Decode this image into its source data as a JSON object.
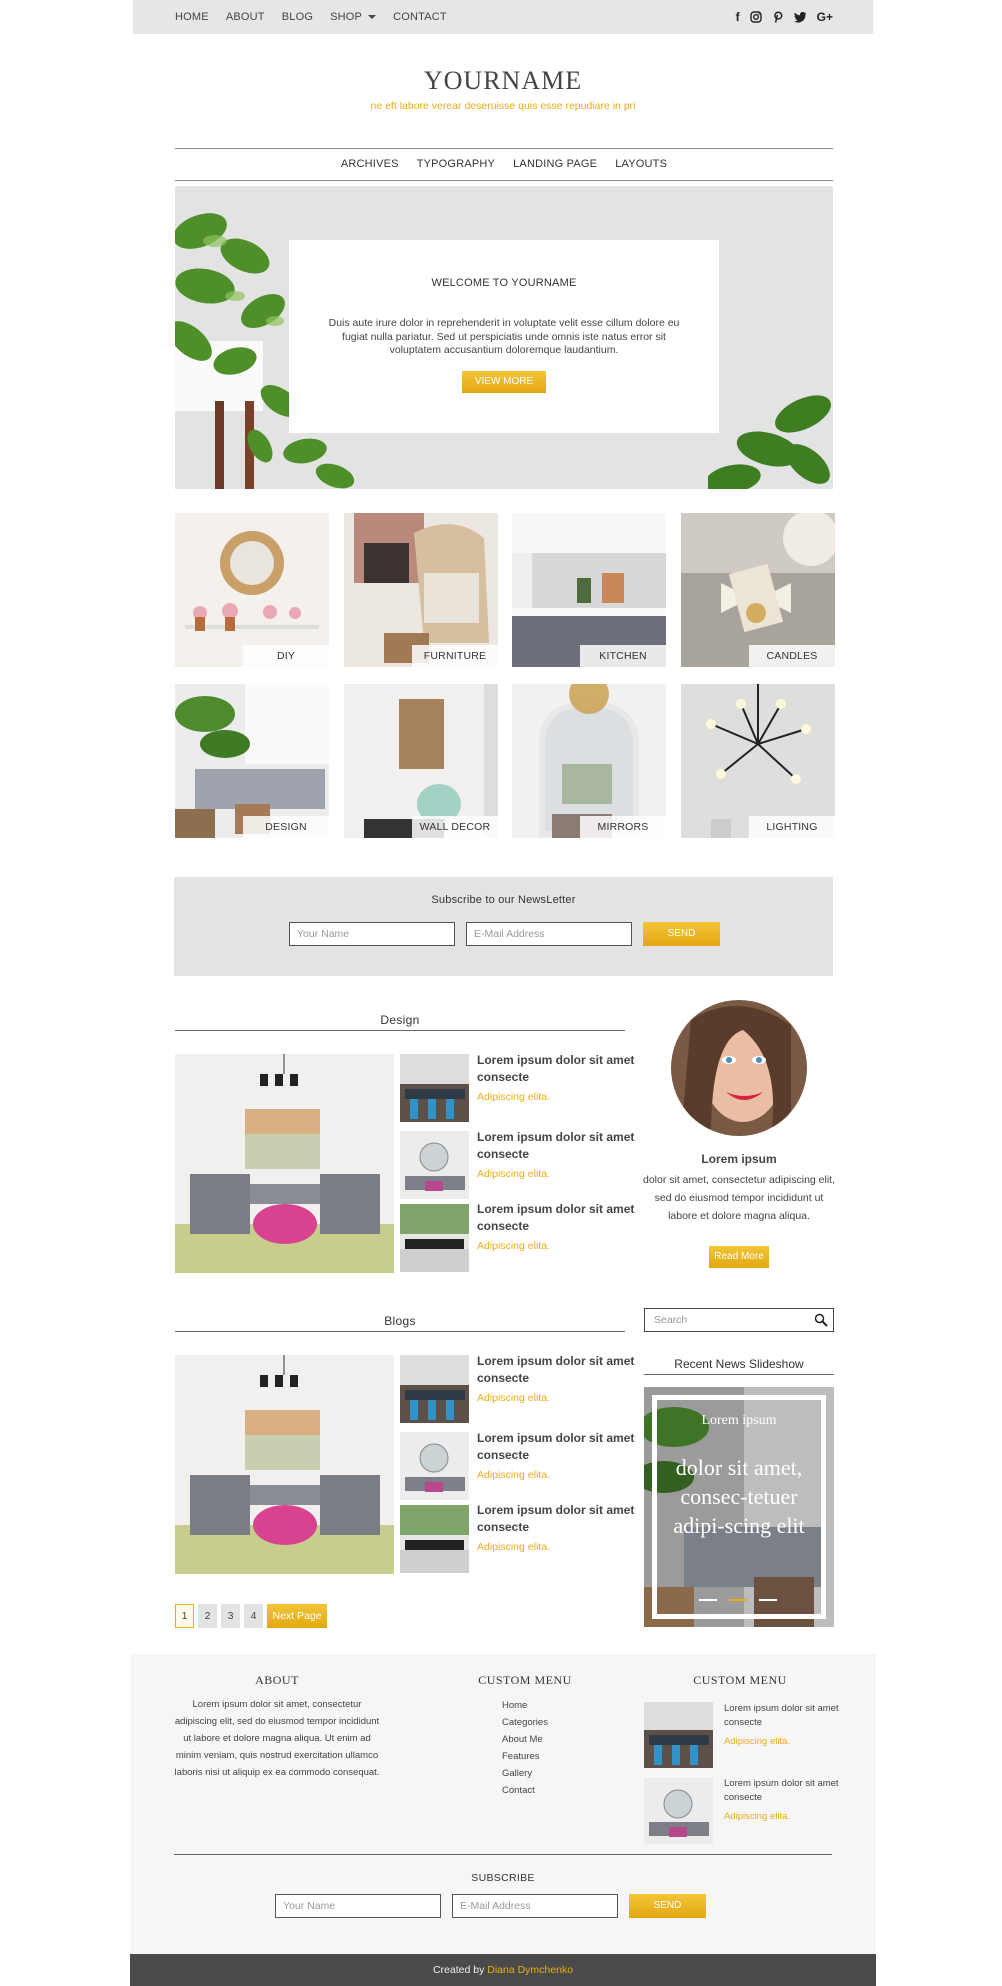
{
  "topnav": {
    "items": [
      "HOME",
      "ABOUT",
      "BLOG",
      "SHOP",
      "CONTACT"
    ],
    "social": [
      "f",
      "instagram",
      "pinterest",
      "twitter",
      "G+"
    ]
  },
  "brand": {
    "name": "YOURNAME",
    "tagline": "ne eft labore verear deseruisse quis esse repudiare in pri"
  },
  "mainnav": [
    "ARCHIVES",
    "TYPOGRAPHY",
    "LANDING PAGE",
    "LAYOUTS"
  ],
  "hero": {
    "title": "WELCOME TO YOURNAME",
    "text": "Duis aute irure dolor in reprehenderit in voluptate velit esse cillum dolore eu fugiat nulla pariatur. Sed ut perspiciatis unde omnis iste natus error sit voluptatem accusantium doloremque laudantium.",
    "button": "VIEW MORE"
  },
  "categories": [
    "DIY",
    "FURNITURE",
    "KITCHEN",
    "CANDLES",
    "DESIGN",
    "WALL DECOR",
    "MIRRORS",
    "LIGHTING"
  ],
  "newsletter": {
    "title": "Subscribe to our NewsLetter",
    "name_placeholder": "Your Name",
    "email_placeholder": "E-Mail Address",
    "send": "SEND"
  },
  "design": {
    "title": "Design",
    "posts": [
      {
        "title": "Lorem ipsum dolor sit amet consecte",
        "sub": "Adipiscing elita."
      },
      {
        "title": "Lorem ipsum dolor sit amet consecte",
        "sub": "Adipiscing elita."
      },
      {
        "title": "Lorem ipsum dolor sit amet consecte",
        "sub": "Adipiscing elita."
      }
    ]
  },
  "blogs": {
    "title": "Blogs",
    "posts": [
      {
        "title": "Lorem ipsum dolor sit amet consecte",
        "sub": "Adipiscing elita."
      },
      {
        "title": "Lorem ipsum dolor sit amet consecte",
        "sub": "Adipiscing elita."
      },
      {
        "title": "Lorem ipsum dolor sit amet consecte",
        "sub": "Adipiscing elita."
      }
    ]
  },
  "profile": {
    "name": "Lorem ipsum",
    "text": "dolor sit amet, consectetur adipiscing elit, sed do eiusmod tempor incididunt ut labore et dolore magna aliqua.",
    "button": "Read More"
  },
  "search": {
    "placeholder": "Search"
  },
  "recent": {
    "title": "Recent News Slideshow",
    "small": "Lorem ipsum",
    "big": "dolor sit amet, consec-tetuer adipi-scing elit"
  },
  "pagination": {
    "pages": [
      "1",
      "2",
      "3",
      "4"
    ],
    "next": "Next Page"
  },
  "footer": {
    "about_title": "ABOUT",
    "about_text": "Lorem ipsum dolor sit amet, consectetur adipiscing elit, sed do eiusmod tempor incididunt ut labore et dolore magna aliqua. Ut enim ad minim veniam, quis nostrud exercitation ullamco laboris nisi ut aliquip ex ea commodo consequat.",
    "menu_title": "CUSTOM MENU",
    "menu_items": [
      "Home",
      "Categories",
      "About Me",
      "Features",
      "Gallery",
      "Contact"
    ],
    "posts_title": "CUSTOM MENU",
    "posts": [
      {
        "title": "Lorem ipsum dolor sit amet consecte",
        "sub": "Adipiscing elita."
      },
      {
        "title": "Lorem ipsum dolor sit amet consecte",
        "sub": "Adipiscing elita."
      }
    ],
    "subscribe_title": "SUBSCRIBE",
    "name_placeholder": "Your Name",
    "email_placeholder": "E-Mail Address",
    "send": "SEND"
  },
  "credit": {
    "prefix": "Created by",
    "author": "Diana Dymchenko"
  },
  "colors": {
    "accent": "#e8ad1a",
    "panel": "#e3e3e3",
    "footer_bar": "#4a4a4a"
  }
}
